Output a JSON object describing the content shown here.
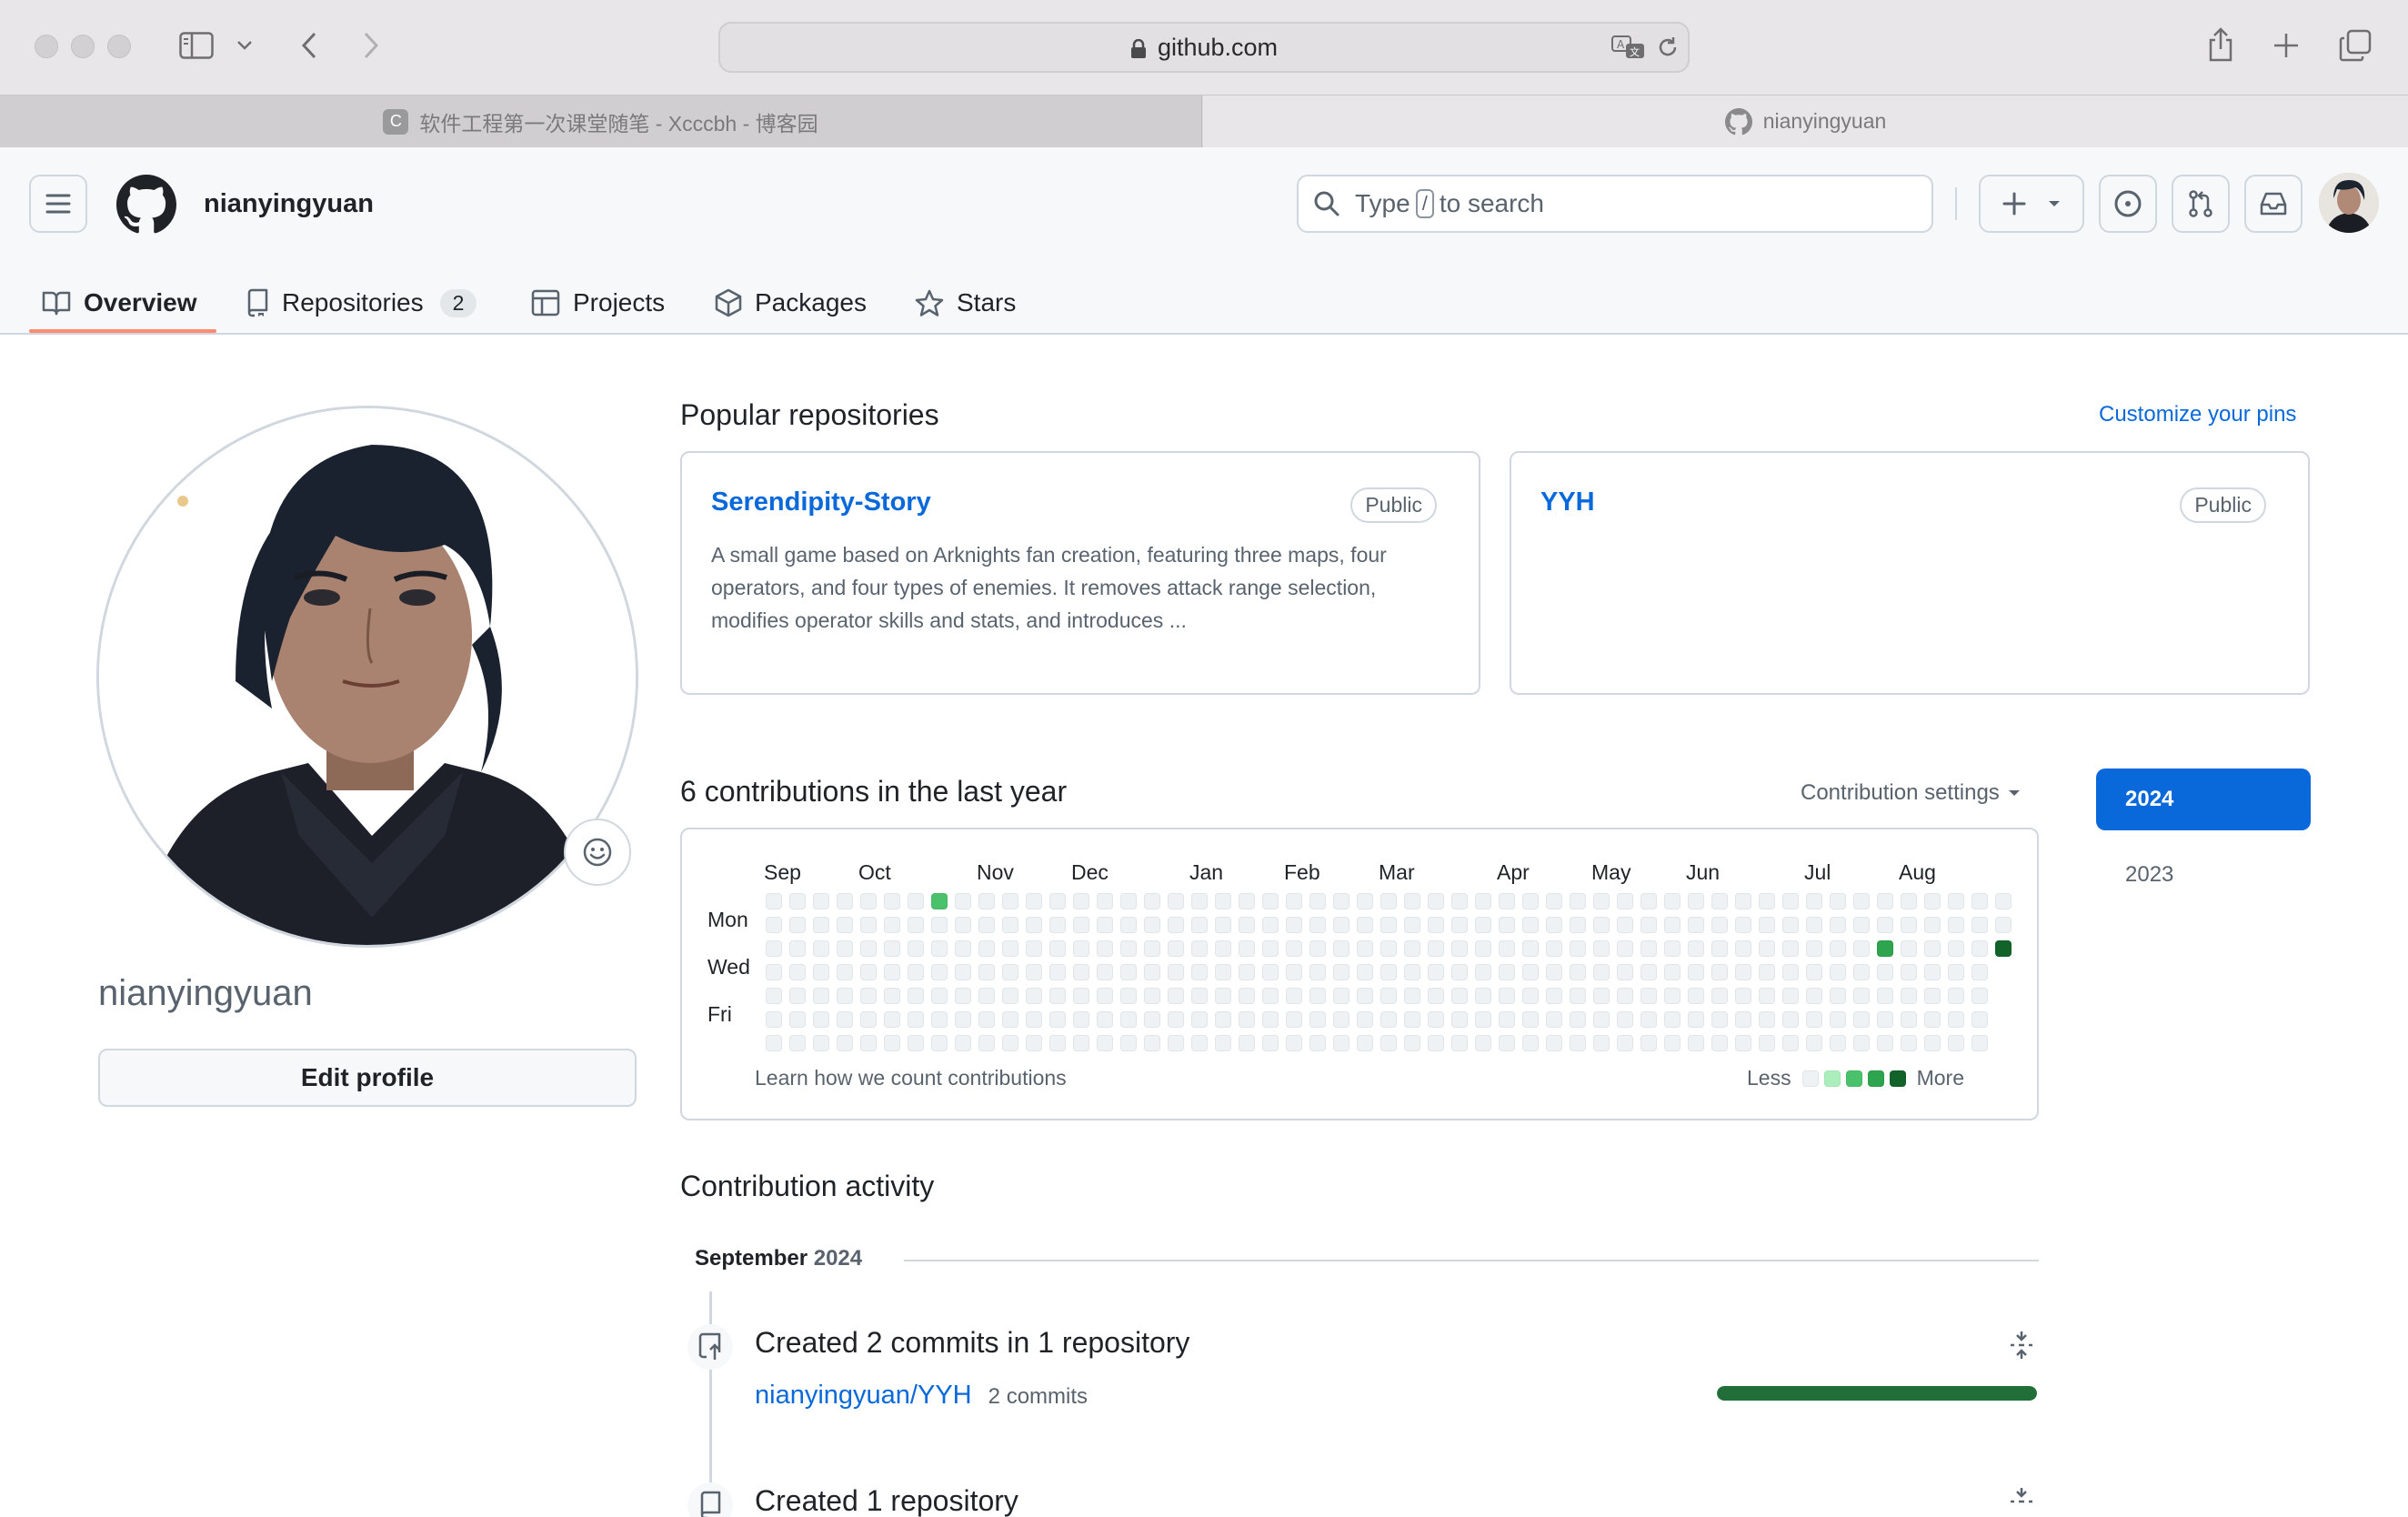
{
  "browser": {
    "url": "github.com",
    "tabs": [
      {
        "title": "软件工程第一次课堂随笔 - Xcccbh - 博客园",
        "favicon_letter": "C"
      },
      {
        "title": "nianyingyuan"
      }
    ]
  },
  "header": {
    "username": "nianyingyuan",
    "search_prefix": "Type",
    "search_key": "/",
    "search_suffix": "to search"
  },
  "nav": {
    "overview": "Overview",
    "repositories": "Repositories",
    "repositories_count": "2",
    "projects": "Projects",
    "packages": "Packages",
    "stars": "Stars"
  },
  "profile": {
    "name": "nianyingyuan",
    "edit_label": "Edit profile"
  },
  "popular": {
    "heading": "Popular repositories",
    "customize": "Customize your pins",
    "repos": [
      {
        "name": "Serendipity-Story",
        "visibility": "Public",
        "description": "A small game based on Arknights fan creation, featuring three maps, four operators, and four types of enemies. It removes attack range selection, modifies operator skills and stats, and introduces ..."
      },
      {
        "name": "YYH",
        "visibility": "Public",
        "description": ""
      }
    ]
  },
  "contributions": {
    "heading": "6 contributions in the last year",
    "settings": "Contribution settings",
    "months": [
      "Sep",
      "Oct",
      "Nov",
      "Dec",
      "Jan",
      "Feb",
      "Mar",
      "Apr",
      "May",
      "Jun",
      "Jul",
      "Aug"
    ],
    "days": [
      "Mon",
      "Wed",
      "Fri"
    ],
    "learn": "Learn how we count contributions",
    "less": "Less",
    "more": "More",
    "legend_colors": [
      "#eff2f5",
      "#aceebb",
      "#4ac26b",
      "#2da44e",
      "#116329"
    ],
    "filled_cells": [
      {
        "week": 7,
        "day": 0,
        "color": "#4ac26b"
      },
      {
        "week": 47,
        "day": 2,
        "color": "#2da44e"
      },
      {
        "week": 52,
        "day": 2,
        "color": "#116329"
      }
    ]
  },
  "years": [
    "2024",
    "2023"
  ],
  "activity": {
    "heading": "Contribution activity",
    "month": "September",
    "year": "2024",
    "item1_title": "Created 2 commits in 1 repository",
    "item1_repo": "nianyingyuan/YYH",
    "item1_commits": "2 commits",
    "item1_fraction": 1.0,
    "item2_title": "Created 1 repository"
  }
}
